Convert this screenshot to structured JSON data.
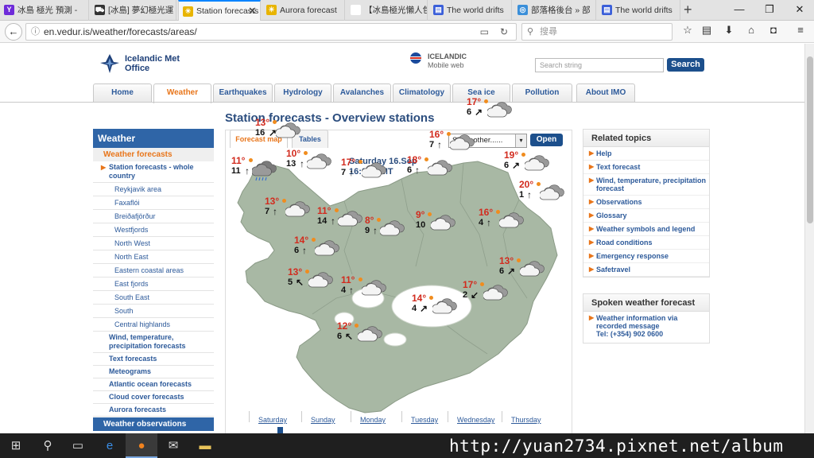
{
  "browser": {
    "tabs": [
      {
        "label": "冰島 極光 預測 -",
        "favicon": "Y",
        "favicon_color": "#6e2bd9"
      },
      {
        "label": "[冰島] 夢幻極光運",
        "favicon": "car-icon",
        "favicon_color": "#333333"
      },
      {
        "label": "Station forecasts",
        "favicon": "sun-icon",
        "favicon_color": "#e8b400",
        "active": true
      },
      {
        "label": "Aurora forecast",
        "favicon": "sun-icon",
        "favicon_color": "#e8b400"
      },
      {
        "label": "【冰島極光懶人包】",
        "favicon": "",
        "favicon_color": "#ffffff"
      },
      {
        "label": "The world drifts",
        "favicon": "page-icon",
        "favicon_color": "#3b5fd9"
      },
      {
        "label": "部落格後台 » 部",
        "favicon": "globe-icon",
        "favicon_color": "#3b8fd9"
      },
      {
        "label": "The world drifts",
        "favicon": "page-icon",
        "favicon_color": "#3b5fd9"
      }
    ],
    "new_tab": "+",
    "url": "en.vedur.is/weather/forecasts/areas/",
    "search_placeholder": "搜尋"
  },
  "site": {
    "logo_line1": "Icelandic Met",
    "logo_line2": "Office",
    "mobile_line1": "ICELANDIC",
    "mobile_line2": "Mobile web",
    "search_placeholder": "Search string",
    "search_button": "Search"
  },
  "mainnav": [
    "Home",
    "Weather",
    "Earthquakes",
    "Hydrology",
    "Avalanches",
    "Climatology",
    "Sea ice",
    "Pollution",
    "About IMO"
  ],
  "sidebar": {
    "title": "Weather",
    "section": "Weather forecasts",
    "items": [
      {
        "label": "Station forecasts - whole country",
        "level": "top",
        "arrow": true
      },
      {
        "label": "Reykjavik area",
        "level": "sub"
      },
      {
        "label": "Faxaflói",
        "level": "sub"
      },
      {
        "label": "Breiðafjörður",
        "level": "sub"
      },
      {
        "label": "Westfjords",
        "level": "sub"
      },
      {
        "label": "North West",
        "level": "sub"
      },
      {
        "label": "North East",
        "level": "sub"
      },
      {
        "label": "Eastern coastal areas",
        "level": "sub"
      },
      {
        "label": "East fjords",
        "level": "sub"
      },
      {
        "label": "South East",
        "level": "sub"
      },
      {
        "label": "South",
        "level": "sub"
      },
      {
        "label": "Central highlands",
        "level": "sub"
      },
      {
        "label": "Wind, temperature, precipitation forecasts",
        "level": "top"
      },
      {
        "label": "Text forecasts",
        "level": "top"
      },
      {
        "label": "Meteograms",
        "level": "top"
      },
      {
        "label": "Atlantic ocean forecasts",
        "level": "top"
      },
      {
        "label": "Cloud cover forecasts",
        "level": "top"
      },
      {
        "label": "Aurora forecasts",
        "level": "top"
      }
    ],
    "footer": "Weather observations"
  },
  "content": {
    "title": "Station forecasts - Overview stations",
    "tabs": [
      "Forecast map",
      "Tables"
    ],
    "select_value": "Show other......",
    "open_button": "Open",
    "map_date": "Saturday 16.Sep",
    "map_time": "16:00 GMT",
    "stations": [
      {
        "temp": "13°",
        "wind": "16",
        "arrow": "↗",
        "weather": "partly-cloudy"
      },
      {
        "temp": "11°",
        "wind": "11",
        "arrow": "↑",
        "weather": "rain"
      },
      {
        "temp": "10°",
        "wind": "13",
        "arrow": "↑",
        "weather": "partly-cloudy"
      },
      {
        "temp": "17°",
        "wind": "7",
        "arrow": "↑",
        "weather": "partly-cloudy"
      },
      {
        "temp": "18°",
        "wind": "6",
        "arrow": "↑",
        "weather": "partly-cloudy"
      },
      {
        "temp": "16°",
        "wind": "7",
        "arrow": "↑",
        "weather": "partly-cloudy"
      },
      {
        "temp": "17°",
        "wind": "6",
        "arrow": "↗",
        "weather": "partly-cloudy"
      },
      {
        "temp": "19°",
        "wind": "6",
        "arrow": "↗",
        "weather": "partly-cloudy"
      },
      {
        "temp": "20°",
        "wind": "1",
        "arrow": "↑",
        "weather": "partly-cloudy"
      },
      {
        "temp": "13°",
        "wind": "7",
        "arrow": "↑",
        "weather": "partly-cloudy"
      },
      {
        "temp": "11°",
        "wind": "14",
        "arrow": "↑",
        "weather": "partly-cloudy"
      },
      {
        "temp": "8°",
        "wind": "9",
        "arrow": "↑",
        "weather": "partly-cloudy"
      },
      {
        "temp": "9°",
        "wind": "10",
        "arrow": "↗",
        "weather": "partly-cloudy"
      },
      {
        "temp": "16°",
        "wind": "4",
        "arrow": "↑",
        "weather": "partly-cloudy"
      },
      {
        "temp": "14°",
        "wind": "6",
        "arrow": "↑",
        "weather": "partly-cloudy"
      },
      {
        "temp": "13°",
        "wind": "5",
        "arrow": "↖",
        "weather": "partly-cloudy"
      },
      {
        "temp": "11°",
        "wind": "4",
        "arrow": "↑",
        "weather": "partly-cloudy"
      },
      {
        "temp": "13°",
        "wind": "6",
        "arrow": "↗",
        "weather": "partly-cloudy"
      },
      {
        "temp": "17°",
        "wind": "2",
        "arrow": "↙",
        "weather": "partly-cloudy"
      },
      {
        "temp": "14°",
        "wind": "4",
        "arrow": "↗",
        "weather": "partly-cloudy"
      },
      {
        "temp": "12°",
        "wind": "6",
        "arrow": "↖",
        "weather": "partly-cloudy"
      }
    ],
    "days": [
      "Saturday",
      "Sunday",
      "Monday",
      "Tuesday",
      "Wednesday",
      "Thursday"
    ]
  },
  "related": {
    "title": "Related topics",
    "items": [
      "Help",
      "Text forecast",
      "Wind, temperature, precipitation forecast",
      "Observations",
      "Glossary",
      "Weather symbols and legend",
      "Road conditions",
      "Emergency response",
      "Safetravel"
    ]
  },
  "spoken": {
    "title": "Spoken weather forecast",
    "item": "Weather information via recorded message",
    "phone": "Tel: (+354) 902 0600"
  },
  "watermark": "http://yuan2734.pixnet.net/album",
  "colors": {
    "accent_orange": "#e8751a",
    "link_blue": "#2d5a9a",
    "header_blue": "#2f65a7",
    "temp_red": "#d22b1e",
    "map_land": "#a8b8a4"
  }
}
